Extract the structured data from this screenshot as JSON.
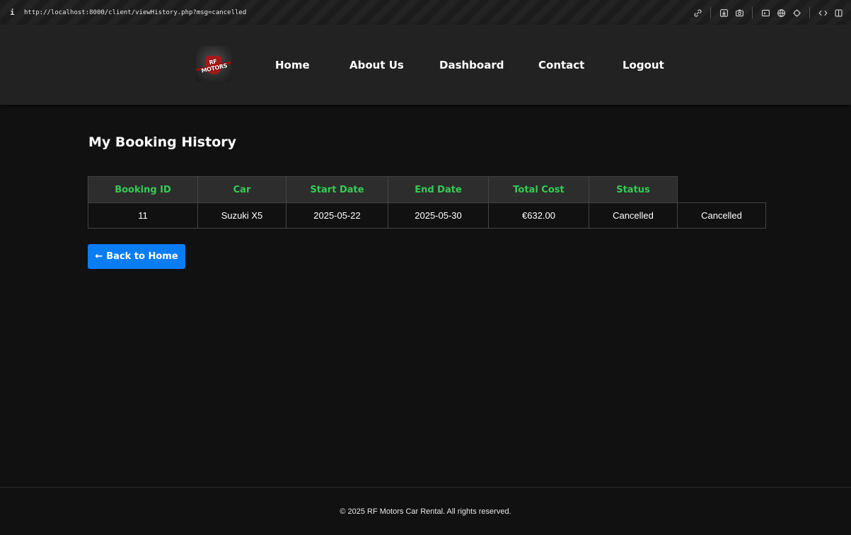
{
  "browser": {
    "info_icon": "i",
    "url": "http://localhost:8000/client/viewHistory.php?msg=cancelled",
    "tool_icons": [
      "link-icon",
      "download-icon",
      "camera-icon",
      "terminal-icon",
      "globe-icon",
      "crosshair-icon",
      "code-icon",
      "sidebar-icon"
    ]
  },
  "header": {
    "logo_text": "RF MOTORS",
    "nav": [
      {
        "label": "Home"
      },
      {
        "label": "About Us"
      },
      {
        "label": "Dashboard"
      },
      {
        "label": "Contact"
      },
      {
        "label": "Logout"
      }
    ]
  },
  "main": {
    "title": "My Booking History",
    "table": {
      "headers": [
        "Booking ID",
        "Car",
        "Start Date",
        "End Date",
        "Total Cost",
        "Status"
      ],
      "rows": [
        [
          "11",
          "Suzuki X5",
          "2025-05-22",
          "2025-05-30",
          "€632.00",
          "Cancelled",
          "Cancelled"
        ]
      ]
    },
    "back_button": {
      "icon": "←",
      "label": "Back to Home"
    }
  },
  "footer": {
    "text": "© 2025 RF Motors Car Rental. All rights reserved."
  },
  "colors": {
    "accent": "#0a7df5",
    "header_text": "#33cc55",
    "background": "#111111"
  }
}
